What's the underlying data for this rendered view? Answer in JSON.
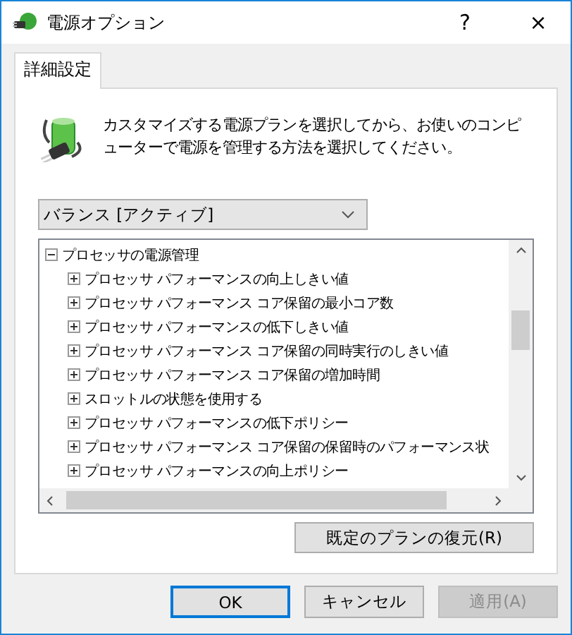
{
  "window": {
    "title": "電源オプション",
    "help": "?",
    "close": "×"
  },
  "tabs": [
    {
      "label": "詳細設定",
      "selected": true
    }
  ],
  "description": "カスタマイズする電源プランを選択してから、お使いのコンピューターで電源を管理する方法を選択してください。",
  "plan_dropdown": {
    "value": "バランス [アクティブ]"
  },
  "tree": [
    {
      "label": "プロセッサの電源管理",
      "expanded": true,
      "children": [
        {
          "label": "プロセッサ パフォーマンスの向上しきい値",
          "expanded": false
        },
        {
          "label": "プロセッサ パフォーマンス コア保留の最小コア数",
          "expanded": false
        },
        {
          "label": "プロセッサ パフォーマンスの低下しきい値",
          "expanded": false
        },
        {
          "label": "プロセッサ パフォーマンス コア保留の同時実行のしきい値",
          "expanded": false
        },
        {
          "label": "プロセッサ パフォーマンス コア保留の増加時間",
          "expanded": false
        },
        {
          "label": "スロットルの状態を使用する",
          "expanded": false
        },
        {
          "label": "プロセッサ パフォーマンスの低下ポリシー",
          "expanded": false
        },
        {
          "label": "プロセッサ パフォーマンス コア保留の保留時のパフォーマンス状",
          "expanded": false
        },
        {
          "label": "プロセッサ パフォーマンスの向上ポリシー",
          "expanded": false
        }
      ]
    }
  ],
  "restore_button": "既定のプランの復元(R)",
  "buttons": [
    {
      "label": "OK",
      "kind": "default",
      "disabled": false
    },
    {
      "label": "キャンセル",
      "kind": "normal",
      "disabled": false
    },
    {
      "label": "適用(A)",
      "kind": "normal",
      "disabled": true
    }
  ]
}
